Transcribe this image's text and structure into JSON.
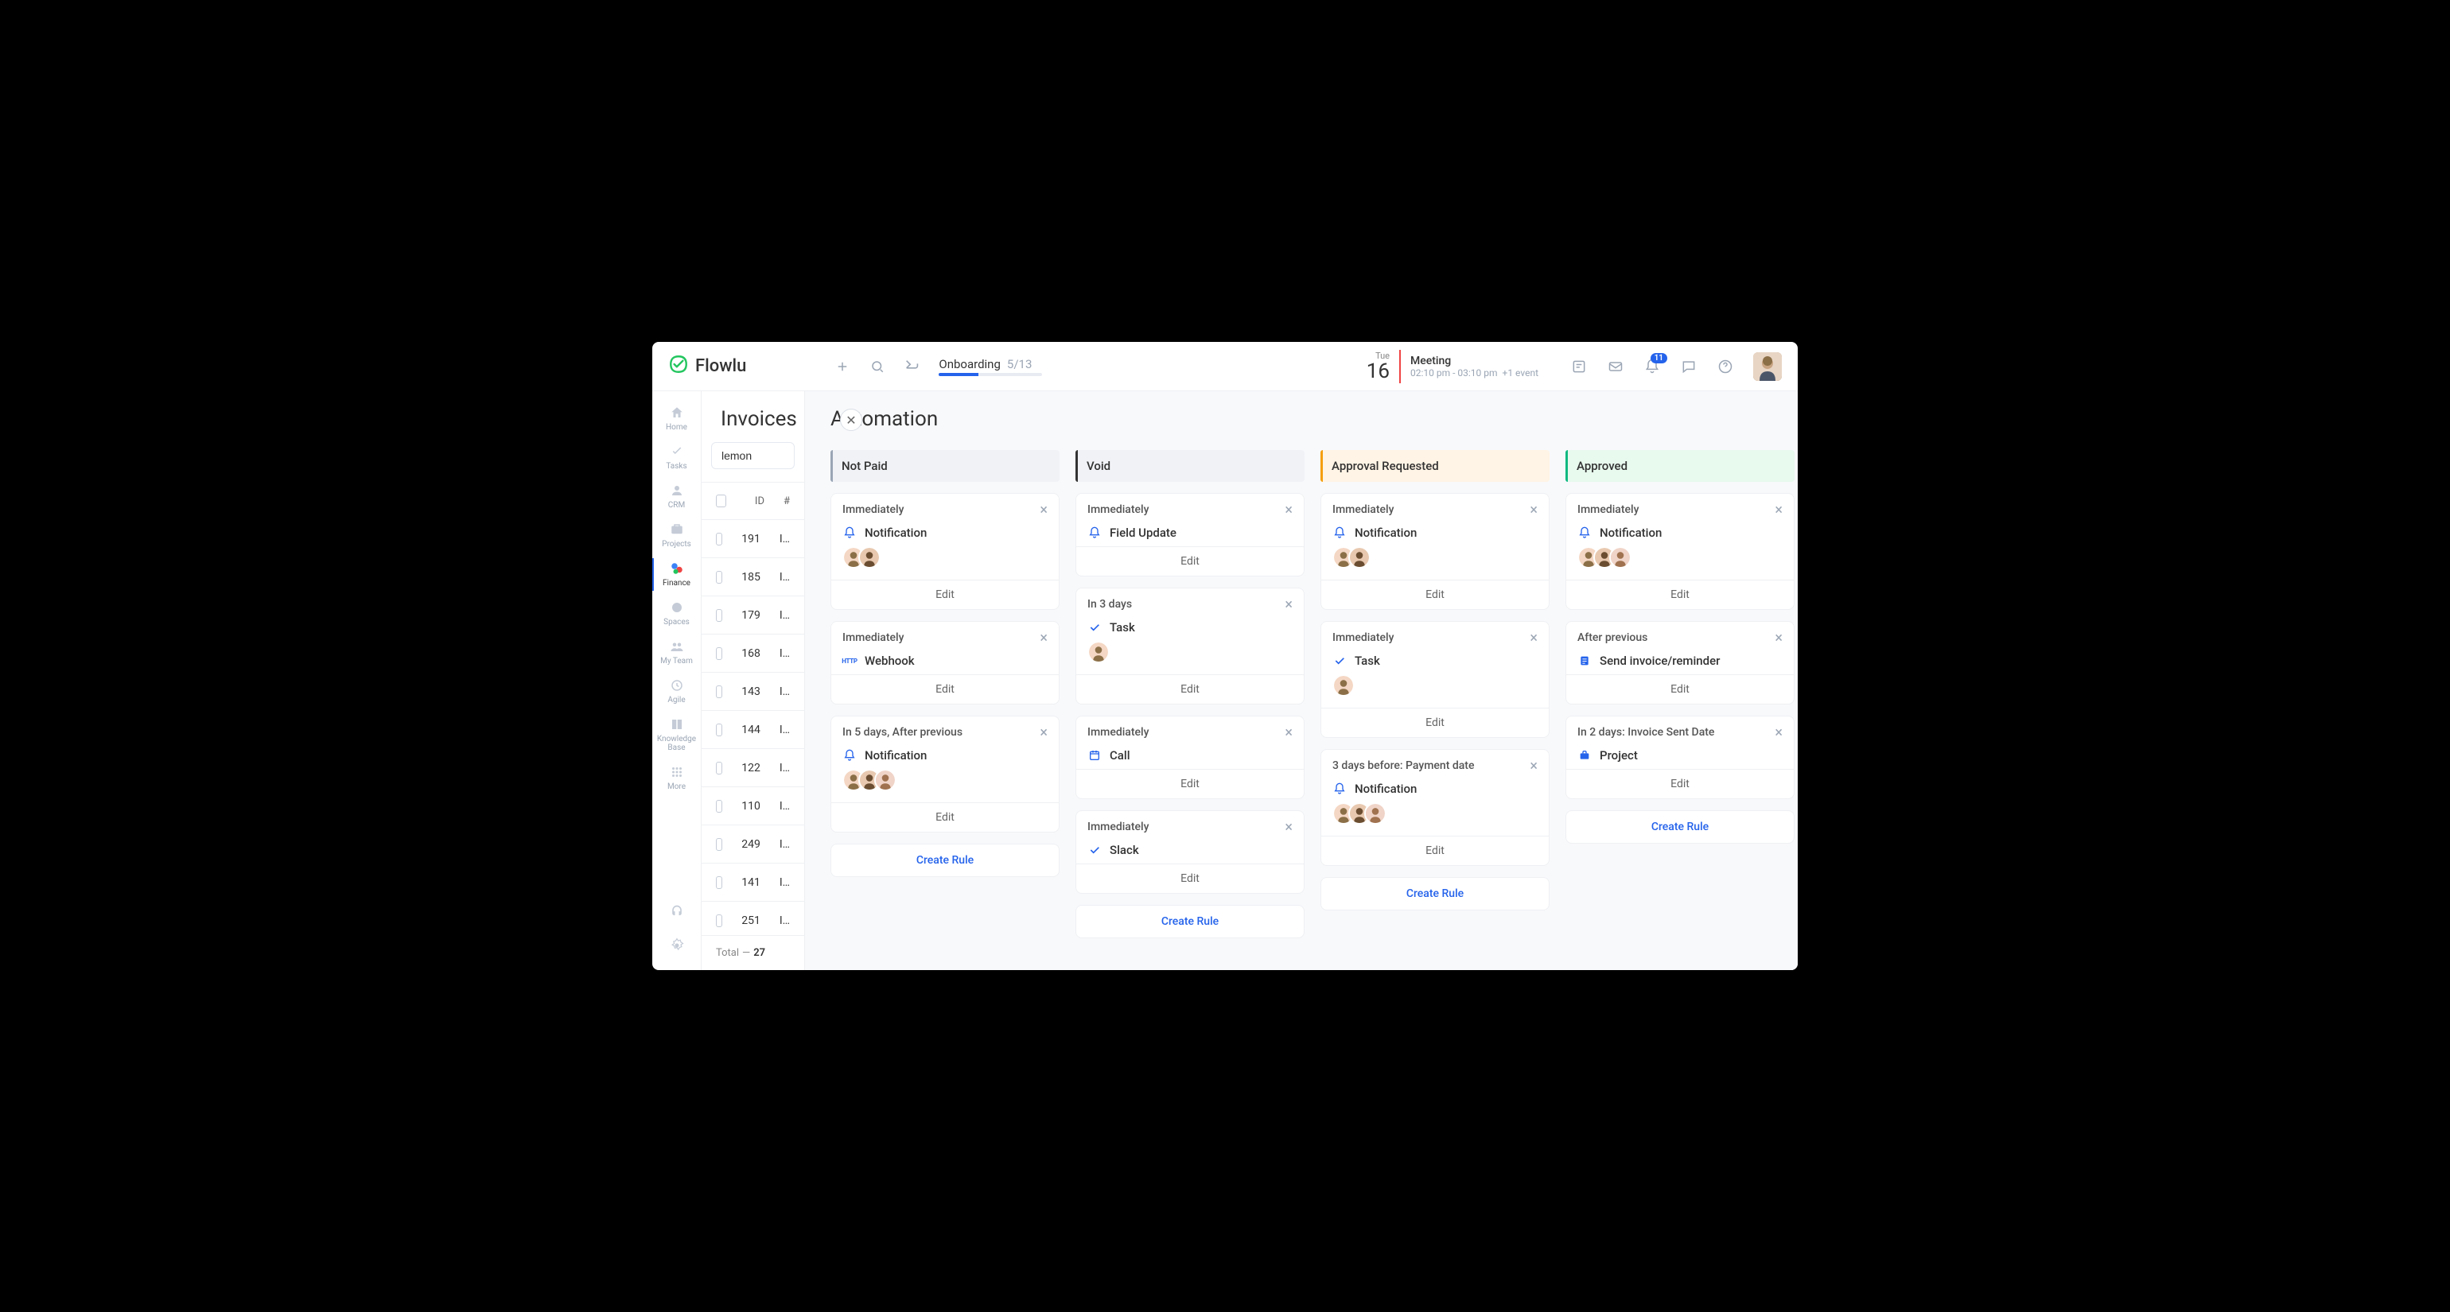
{
  "brand": "Flowlu",
  "topbar": {
    "onboarding_label": "Onboarding",
    "onboarding_progress": "5/13",
    "calendar_day": "Tue",
    "calendar_date": "16",
    "event_title": "Meeting",
    "event_time": "02:10 pm - 03:10 pm",
    "event_more": "+1 event",
    "notif_count": "11"
  },
  "sidenav": {
    "home": "Home",
    "tasks": "Tasks",
    "crm": "CRM",
    "projects": "Projects",
    "finance": "Finance",
    "spaces": "Spaces",
    "myteam": "My Team",
    "agile": "Agile",
    "kb": "Knowledge\nBase",
    "more": "More"
  },
  "invoices": {
    "title": "Invoices",
    "search_value": "lemon",
    "col_id": "ID",
    "col_hash": "#",
    "rows": [
      "191",
      "185",
      "179",
      "168",
      "143",
      "144",
      "122",
      "110",
      "249",
      "141",
      "251"
    ],
    "total_label": "Total",
    "total_count": "27"
  },
  "automation": {
    "title": "Automation",
    "columns": [
      {
        "name": "Not Paid",
        "colorClass": "col-gray",
        "cards": [
          {
            "timing": "Immediately",
            "action": "Notification",
            "icon": "bell",
            "avatars": 2,
            "edit": "Edit"
          },
          {
            "timing": "Immediately",
            "action": "Webhook",
            "icon": "http",
            "avatars": 0,
            "edit": "Edit"
          },
          {
            "timing": "In 5 days, After previous",
            "action": "Notification",
            "icon": "bell",
            "avatars": 3,
            "edit": "Edit"
          }
        ],
        "createRule": "Create Rule"
      },
      {
        "name": "Void",
        "colorClass": "col-dark",
        "cards": [
          {
            "timing": "Immediately",
            "action": "Field Update",
            "icon": "bell",
            "avatars": 0,
            "edit": "Edit"
          },
          {
            "timing": "In 3 days",
            "action": "Task",
            "icon": "check",
            "avatars": 1,
            "edit": "Edit"
          },
          {
            "timing": "Immediately",
            "action": "Call",
            "icon": "calendar",
            "avatars": 0,
            "edit": "Edit"
          },
          {
            "timing": "Immediately",
            "action": "Slack",
            "icon": "check",
            "avatars": 0,
            "edit": "Edit"
          }
        ],
        "createRule": "Create Rule"
      },
      {
        "name": "Approval Requested",
        "colorClass": "col-orange",
        "cards": [
          {
            "timing": "Immediately",
            "action": "Notification",
            "icon": "bell",
            "avatars": 2,
            "edit": "Edit"
          },
          {
            "timing": "Immediately",
            "action": "Task",
            "icon": "check",
            "avatars": 1,
            "edit": "Edit"
          },
          {
            "timing": "3 days before: Payment date",
            "action": "Notification",
            "icon": "bell",
            "avatars": 3,
            "edit": "Edit"
          }
        ],
        "createRule": "Create Rule"
      },
      {
        "name": "Approved",
        "colorClass": "col-green",
        "cards": [
          {
            "timing": "Immediately",
            "action": "Notification",
            "icon": "bell",
            "avatars": 3,
            "edit": "Edit"
          },
          {
            "timing": "After previous",
            "action": "Send invoice/reminder",
            "icon": "doc",
            "avatars": 0,
            "edit": "Edit"
          },
          {
            "timing": "In 2 days: Invoice Sent Date",
            "action": "Project",
            "icon": "briefcase",
            "avatars": 0,
            "edit": "Edit"
          }
        ],
        "createRule": "Create Rule"
      }
    ]
  }
}
